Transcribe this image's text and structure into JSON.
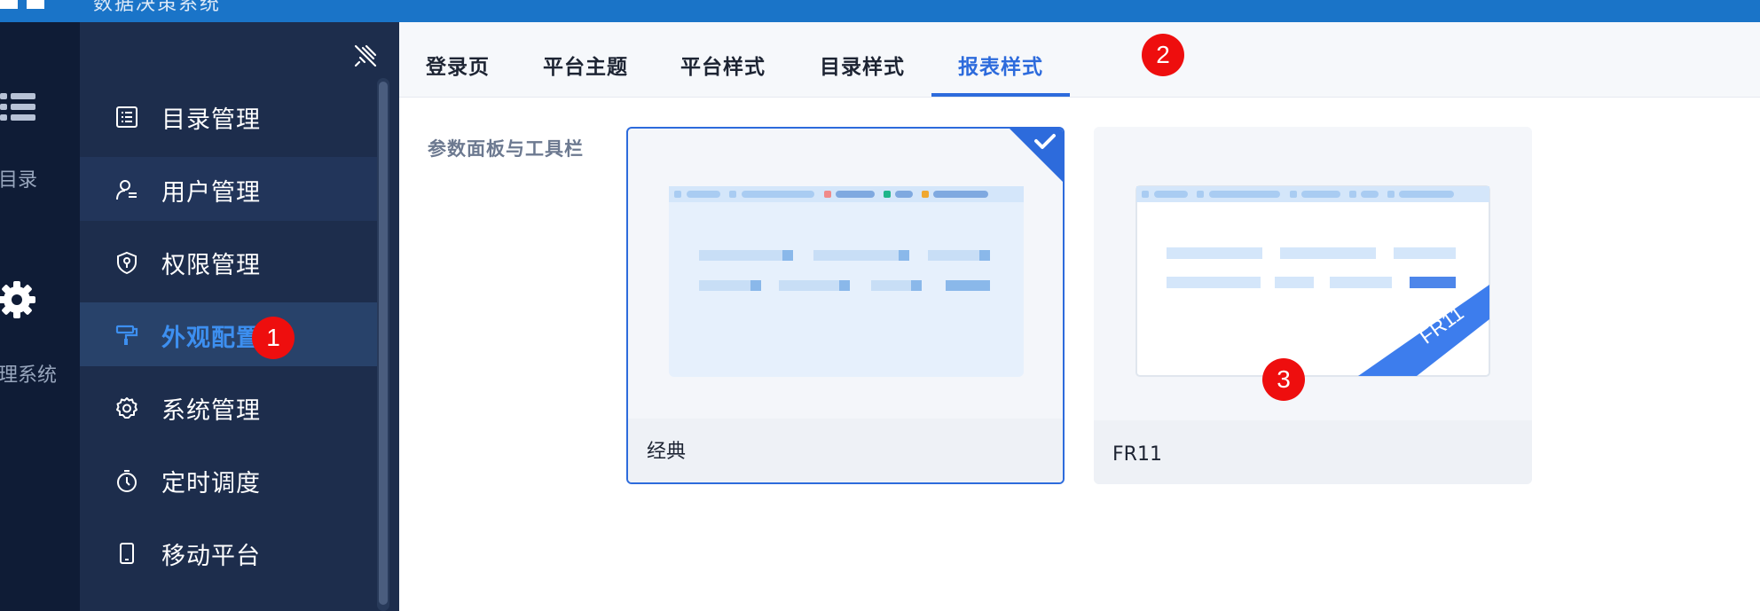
{
  "header": {
    "title": "数据决策系统"
  },
  "rail": {
    "items": [
      {
        "label": "目录",
        "icon": "list-icon"
      },
      {
        "label": "管理系统",
        "icon": "gear-icon"
      }
    ]
  },
  "sidebar": {
    "items": [
      {
        "label": "目录管理",
        "icon": "catalog-list-icon"
      },
      {
        "label": "用户管理",
        "icon": "user-icon"
      },
      {
        "label": "权限管理",
        "icon": "shield-icon"
      },
      {
        "label": "外观配置",
        "icon": "paint-roller-icon",
        "active": true
      },
      {
        "label": "系统管理",
        "icon": "gear-icon"
      },
      {
        "label": "定时调度",
        "icon": "timer-icon"
      },
      {
        "label": "移动平台",
        "icon": "mobile-icon"
      }
    ]
  },
  "tabs": [
    {
      "label": "登录页"
    },
    {
      "label": "平台主题"
    },
    {
      "label": "平台样式"
    },
    {
      "label": "目录样式"
    },
    {
      "label": "报表样式",
      "active": true
    }
  ],
  "section": {
    "label": "参数面板与工具栏"
  },
  "styles": [
    {
      "name": "经典",
      "selected": true
    },
    {
      "name": "FR11",
      "selected": false,
      "ribbon": "FR11"
    }
  ],
  "annotations": [
    "1",
    "2",
    "3"
  ],
  "colors": {
    "accent": "#2d6bdc",
    "sidebar": "#1d2d4c",
    "rail": "#0f1c36",
    "topbar": "#1a74c8",
    "badge": "#ee0e0e"
  }
}
